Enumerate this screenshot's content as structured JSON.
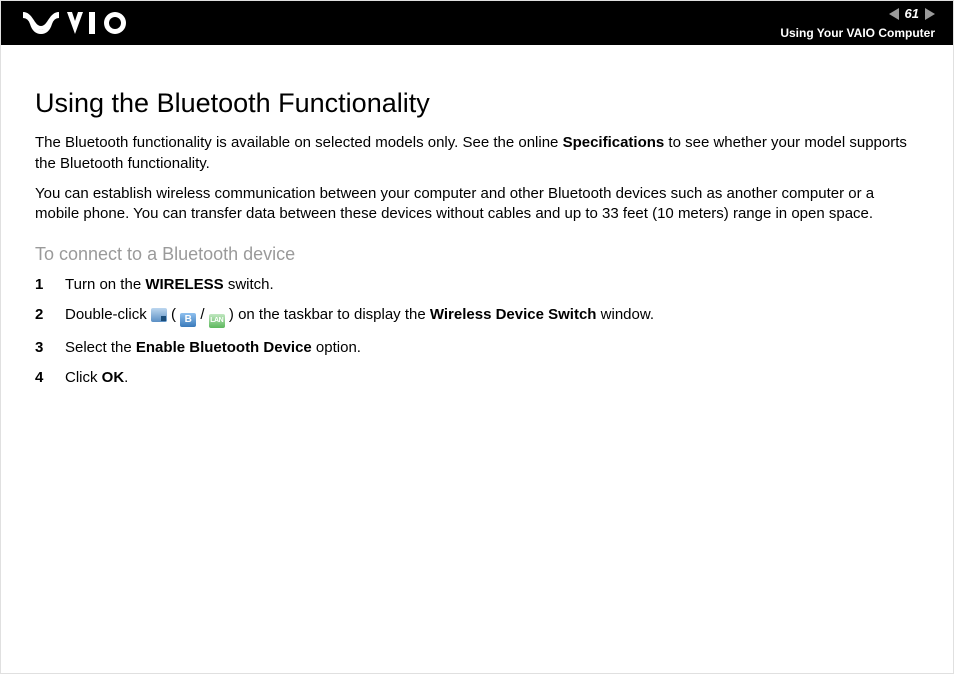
{
  "header": {
    "page_number": "61",
    "section": "Using Your VAIO Computer"
  },
  "main": {
    "title": "Using the Bluetooth Functionality",
    "p1a": "The Bluetooth functionality is available on selected models only. See the online ",
    "p1b": "Specifications",
    "p1c": " to see whether your model supports the Bluetooth functionality.",
    "p2": "You can establish wireless communication between your computer and other Bluetooth devices such as another computer or a mobile phone. You can transfer data between these devices without cables and up to 33 feet (10 meters) range in open space.",
    "subheading": "To connect to a Bluetooth device",
    "steps": {
      "s1a": "Turn on the ",
      "s1b": "WIRELESS",
      "s1c": " switch.",
      "s2a": "Double-click ",
      "s2b": " ( ",
      "s2c": " / ",
      "s2d": " ) on the taskbar to display the ",
      "s2e": "Wireless Device Switch",
      "s2f": " window.",
      "s3a": "Select the ",
      "s3b": "Enable Bluetooth Device",
      "s3c": " option.",
      "s4a": "Click ",
      "s4b": "OK",
      "s4c": "."
    }
  },
  "icons": {
    "b_label": "B",
    "lan_label": "LAN"
  }
}
